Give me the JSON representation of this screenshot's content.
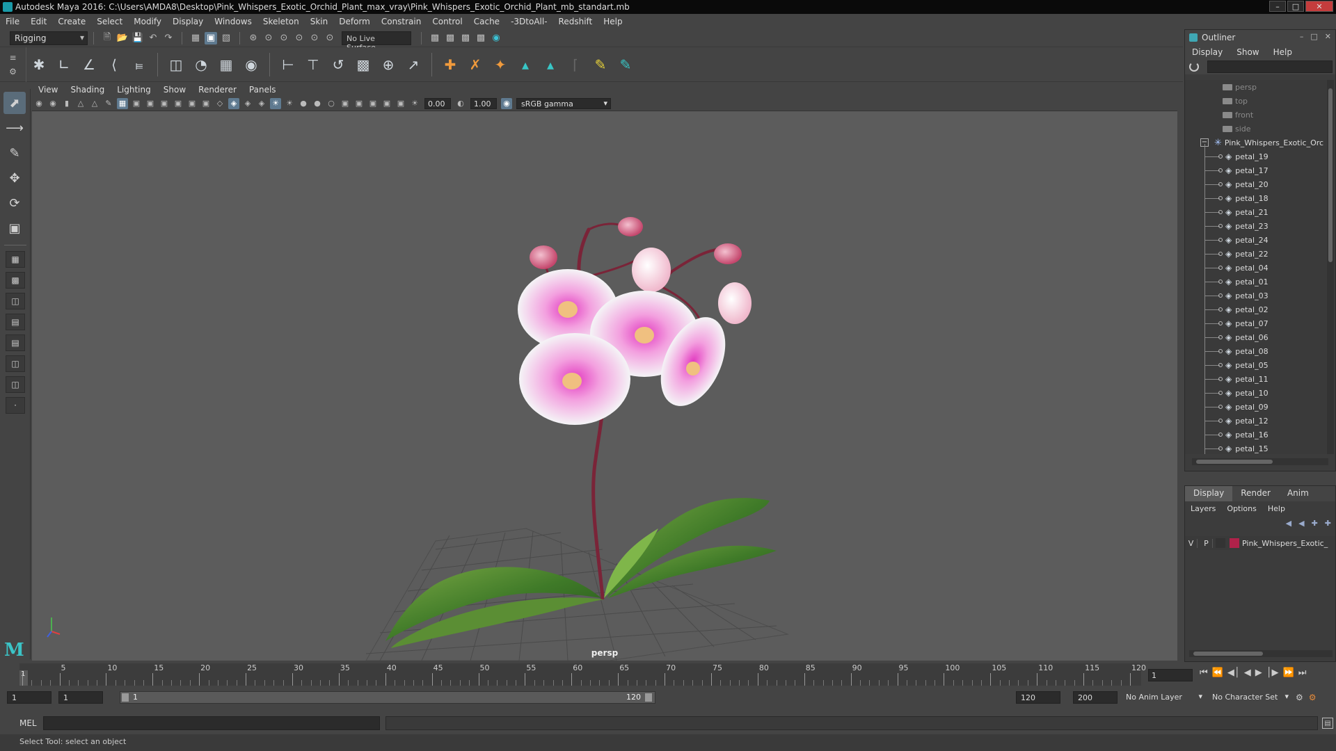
{
  "window": {
    "title": "Autodesk Maya 2016: C:\\Users\\AMDA8\\Desktop\\Pink_Whispers_Exotic_Orchid_Plant_max_vray\\Pink_Whispers_Exotic_Orchid_Plant_mb_standart.mb"
  },
  "menubar": [
    "File",
    "Edit",
    "Create",
    "Select",
    "Modify",
    "Display",
    "Windows",
    "Skeleton",
    "Skin",
    "Deform",
    "Constrain",
    "Control",
    "Cache",
    "-3DtoAll-",
    "Redshift",
    "Help"
  ],
  "statusline": {
    "menuset": "Rigging",
    "live_surface": "No Live Surface"
  },
  "panel": {
    "menus": [
      "View",
      "Shading",
      "Lighting",
      "Show",
      "Renderer",
      "Panels"
    ],
    "exposure": "0.00",
    "gamma": "1.00",
    "color_space": "sRGB gamma",
    "camera": "persp"
  },
  "outliner": {
    "title": "Outliner",
    "menus": [
      "Display",
      "Show",
      "Help"
    ],
    "cameras": [
      "persp",
      "top",
      "front",
      "side"
    ],
    "group": "Pink_Whispers_Exotic_Orc",
    "items": [
      "petal_19",
      "petal_17",
      "petal_20",
      "petal_18",
      "petal_21",
      "petal_23",
      "petal_24",
      "petal_22",
      "petal_04",
      "petal_01",
      "petal_03",
      "petal_02",
      "petal_07",
      "petal_06",
      "petal_08",
      "petal_05",
      "petal_11",
      "petal_10",
      "petal_09",
      "petal_12",
      "petal_16",
      "petal_15"
    ]
  },
  "layer_editor": {
    "tabs": [
      "Display",
      "Render",
      "Anim"
    ],
    "menus": [
      "Layers",
      "Options",
      "Help"
    ],
    "layer": {
      "v": "V",
      "p": "P",
      "name": "Pink_Whispers_Exotic_",
      "color": "#b0224a"
    }
  },
  "timeline": {
    "ticks": [
      "1",
      "5",
      "10",
      "15",
      "20",
      "25",
      "30",
      "35",
      "40",
      "45",
      "50",
      "55",
      "60",
      "65",
      "70",
      "75",
      "80",
      "85",
      "90",
      "95",
      "100",
      "105",
      "110",
      "115",
      "120"
    ],
    "current_frame": "1"
  },
  "range": {
    "start_time": "1",
    "playback_start": "1",
    "range_start": "1",
    "range_end": "120",
    "playback_end": "120",
    "end_time": "200",
    "anim_layer": "No Anim Layer",
    "character_set": "No Character Set"
  },
  "command_line": {
    "label": "MEL"
  },
  "help_line": "Select Tool: select an object"
}
